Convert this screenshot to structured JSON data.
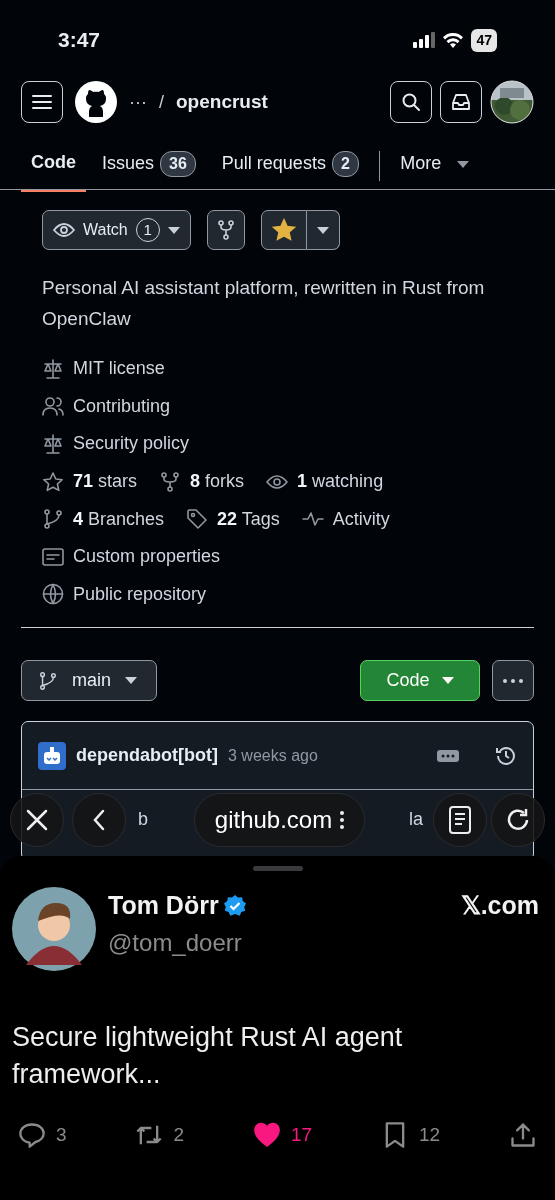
{
  "status_bar": {
    "time": "3:47",
    "battery": "47"
  },
  "header": {
    "breadcrumb_more": "···",
    "separator": "/",
    "repo": "opencrust"
  },
  "tabs": [
    {
      "label": "Code",
      "selected": true
    },
    {
      "label": "Issues",
      "count": "36",
      "selected": false
    },
    {
      "label": "Pull requests",
      "count": "2",
      "selected": false
    }
  ],
  "more_tab": "More",
  "repo_actions": {
    "watch_label": "Watch",
    "watch_count": "1",
    "starred": true
  },
  "description": "Personal AI assistant platform, rewritten in Rust from OpenClaw",
  "meta": [
    {
      "kind": "license",
      "items": [
        {
          "text": "MIT license"
        }
      ]
    },
    {
      "kind": "contributing",
      "items": [
        {
          "text": "Contributing"
        }
      ]
    },
    {
      "kind": "security",
      "items": [
        {
          "text": "Security policy"
        }
      ]
    },
    {
      "items": [
        {
          "kind": "star",
          "count": "71",
          "text": "stars"
        },
        {
          "kind": "fork",
          "count": "8",
          "text": "forks"
        },
        {
          "kind": "eye",
          "count": "1",
          "text": "watching"
        }
      ]
    },
    {
      "items": [
        {
          "kind": "branch",
          "count": "4",
          "text": "Branches"
        },
        {
          "kind": "tag",
          "count": "22",
          "text": "Tags"
        },
        {
          "kind": "pulse",
          "text": "Activity"
        }
      ]
    },
    {
      "kind": "properties",
      "items": [
        {
          "text": "Custom properties"
        }
      ]
    },
    {
      "kind": "public",
      "items": [
        {
          "text": "Public repository"
        }
      ]
    }
  ],
  "branch": {
    "name": "main"
  },
  "code_button": "Code",
  "commit": {
    "author": "dependabot[bot]",
    "time": "3 weeks ago"
  },
  "file_row_fragments": [
    "b",
    "la"
  ],
  "browser_toolbar": {
    "address": "github.com"
  },
  "tweet": {
    "name": "Tom Dörr",
    "verified": true,
    "handle": "@tom_doerr",
    "source": "𝕏.com",
    "text": "Secure lightweight Rust AI agent framework...",
    "actions": [
      {
        "kind": "reply",
        "count": "3",
        "selected": false
      },
      {
        "kind": "repost",
        "count": "2",
        "selected": false
      },
      {
        "kind": "like",
        "count": "17",
        "selected": true
      },
      {
        "kind": "bookmark",
        "count": "12",
        "selected": false
      },
      {
        "kind": "share",
        "selected": false
      }
    ]
  }
}
